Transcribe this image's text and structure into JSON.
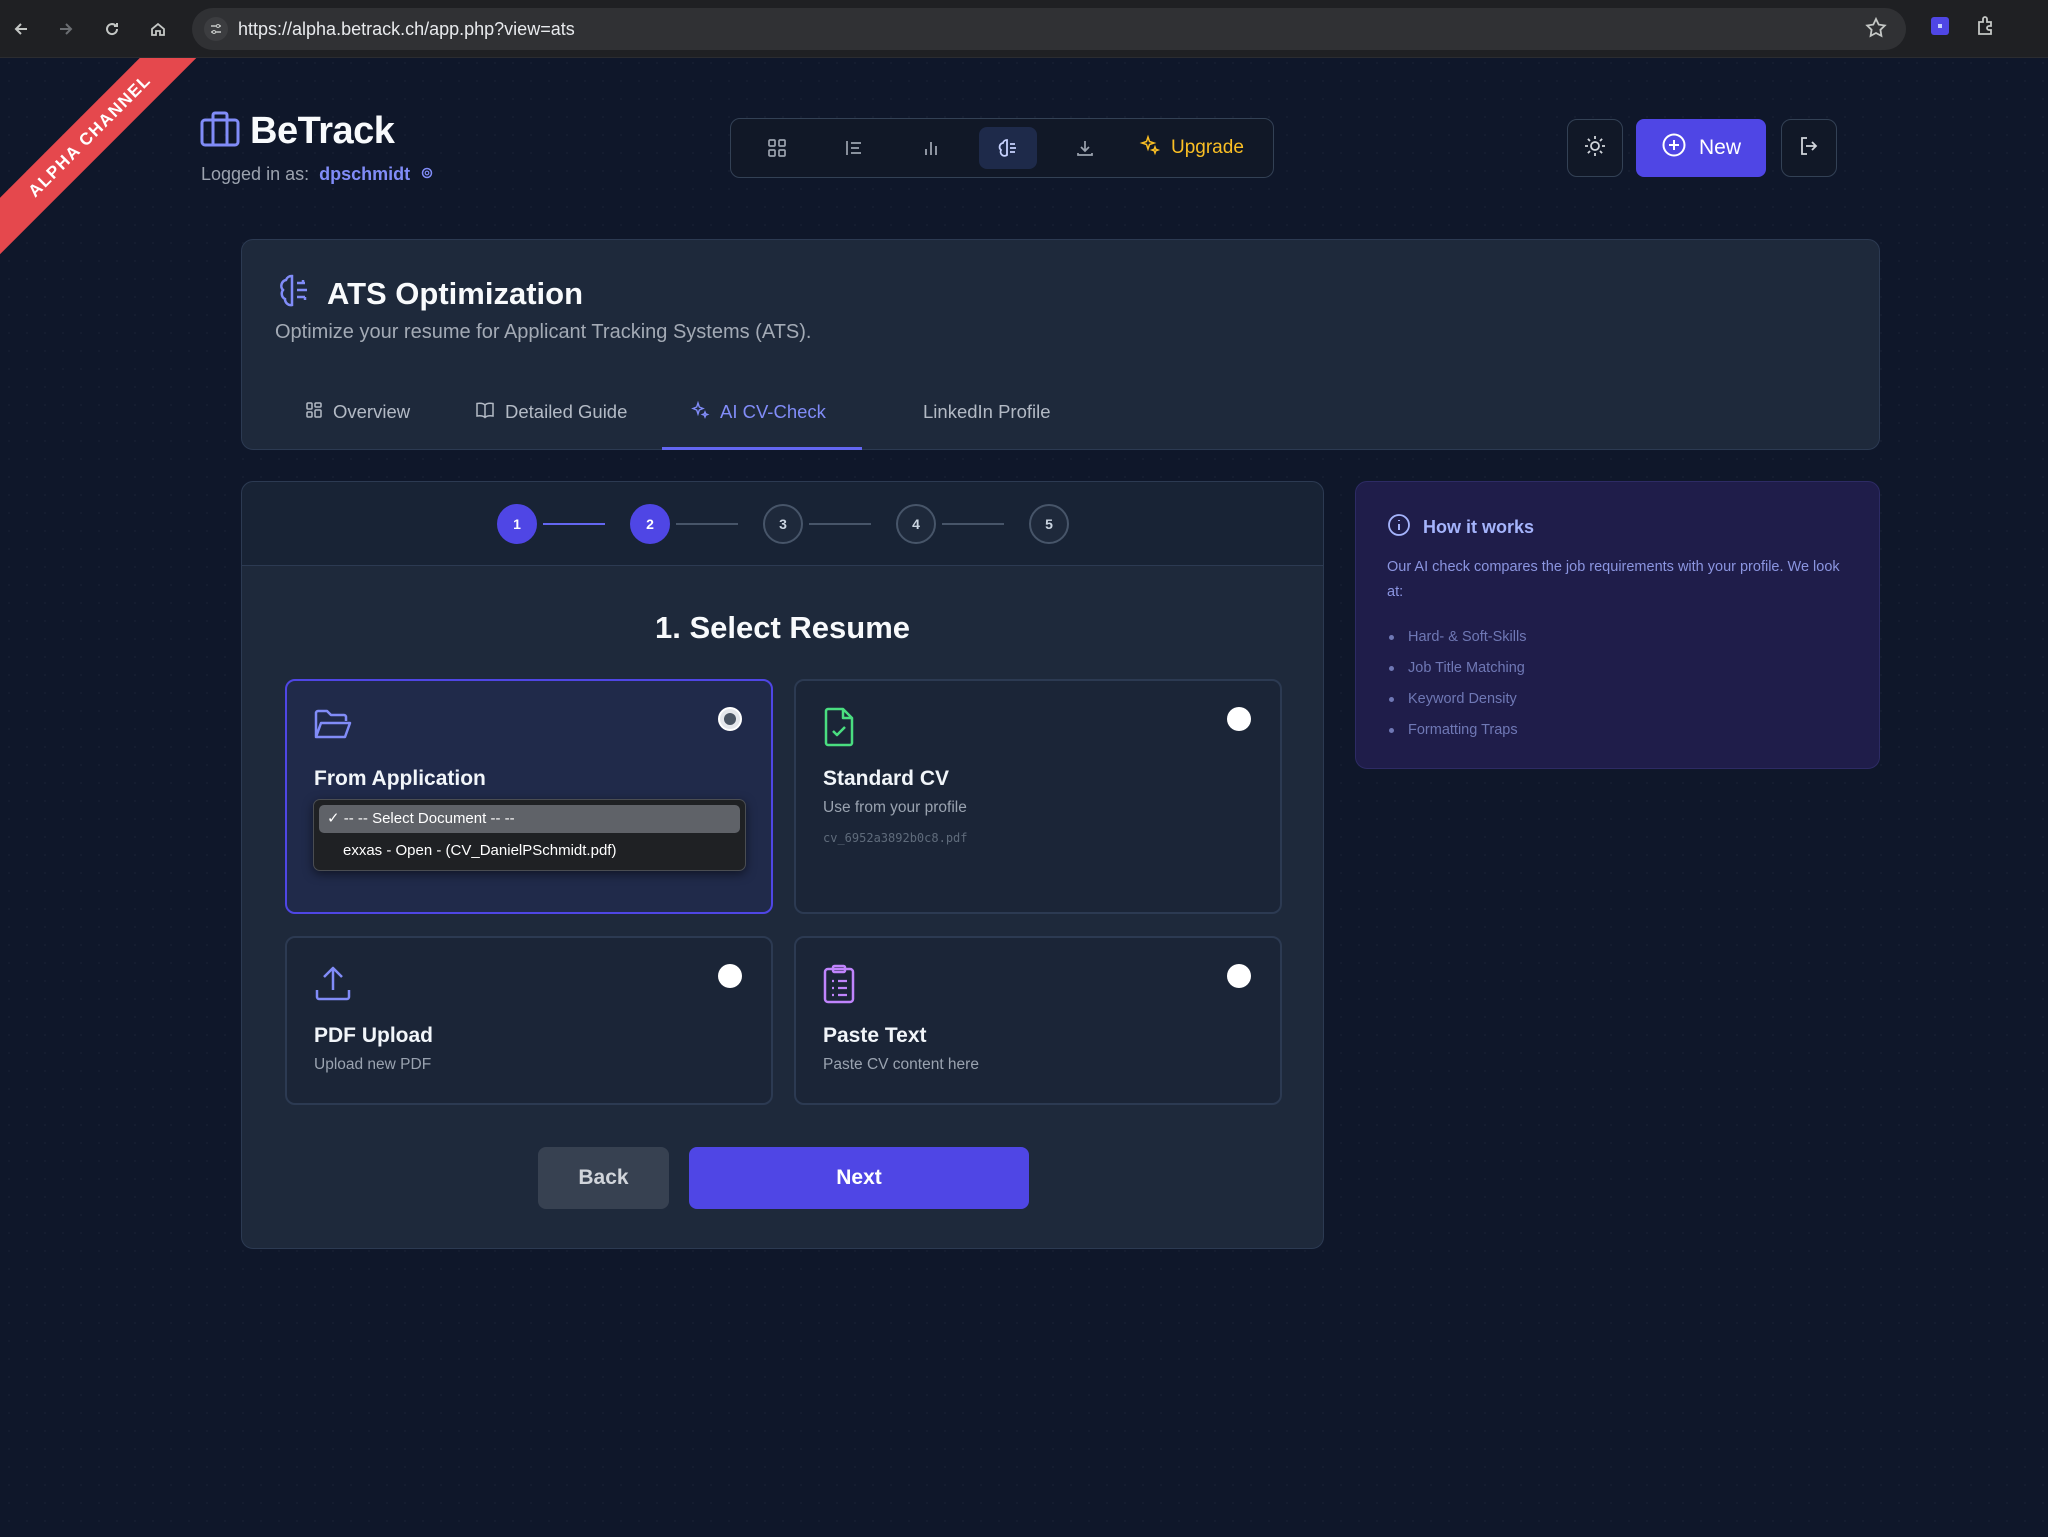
{
  "browser": {
    "url": "https://alpha.betrack.ch/app.php?view=ats"
  },
  "ribbon": {
    "label": "ALPHA CHANNEL"
  },
  "header": {
    "brand": "BeTrack",
    "logged_in_label": "Logged in as:",
    "username": "dpschmidt",
    "upgrade_label": "Upgrade",
    "new_label": "New"
  },
  "ats": {
    "title": "ATS Optimization",
    "subtitle": "Optimize your resume for Applicant Tracking Systems (ATS).",
    "tabs": [
      {
        "label": "Overview"
      },
      {
        "label": "Detailed Guide"
      },
      {
        "label": "AI CV-Check"
      },
      {
        "label": "LinkedIn Profile"
      }
    ],
    "active_tab": "AI CV-Check"
  },
  "wizard": {
    "steps": [
      "1",
      "2",
      "3",
      "4",
      "5"
    ],
    "current_step": 2,
    "title": "1. Select Resume",
    "options": [
      {
        "title": "From Application",
        "selected": true
      },
      {
        "title": "Standard CV",
        "desc": "Use from your profile",
        "file": "cv_6952a3892b0c8.pdf"
      },
      {
        "title": "PDF Upload",
        "desc": "Upload new PDF"
      },
      {
        "title": "Paste Text",
        "desc": "Paste CV content here"
      }
    ],
    "dropdown": {
      "selected": "-- -- Select Document -- --",
      "options": [
        "exxas - Open - (CV_DanielPSchmidt.pdf)"
      ]
    },
    "back_label": "Back",
    "next_label": "Next"
  },
  "info": {
    "title": "How it works",
    "text": "Our AI check compares the job requirements with your profile. We look at:",
    "items": [
      "Hard- & Soft-Skills",
      "Job Title Matching",
      "Keyword Density",
      "Formatting Traps"
    ]
  },
  "colors": {
    "accent": "#4f46e5",
    "upgrade": "#fbbf24",
    "ribbon": "#e5484d",
    "background": "#0f172a"
  }
}
